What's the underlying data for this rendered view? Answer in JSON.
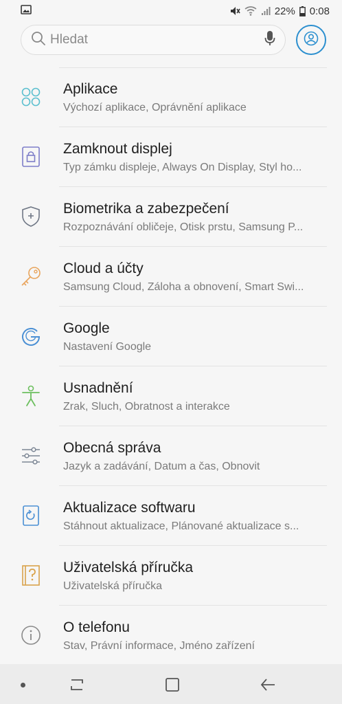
{
  "status_bar": {
    "battery": "22%",
    "time": "0:08",
    "icons": [
      "image-icon",
      "mute-icon",
      "wifi-icon",
      "signal-icon",
      "battery-icon"
    ]
  },
  "search": {
    "placeholder": "Hledat",
    "icons": [
      "search-icon",
      "microphone-icon",
      "profile-icon"
    ]
  },
  "items": [
    {
      "title": "Aplikace",
      "subtitle": "Výchozí aplikace, Oprávnění aplikace",
      "icon": "apps-icon",
      "color": "#5bbfcf"
    },
    {
      "title": "Zamknout displej",
      "subtitle": "Typ zámku displeje, Always On Display, Styl ho...",
      "icon": "lock-icon",
      "color": "#7d7dc8"
    },
    {
      "title": "Biometrika a zabezpečení",
      "subtitle": "Rozpoznávání obličeje, Otisk prstu, Samsung P...",
      "icon": "shield-icon",
      "color": "#6f7785"
    },
    {
      "title": "Cloud a účty",
      "subtitle": "Samsung Cloud, Záloha a obnovení, Smart Swi...",
      "icon": "key-icon",
      "color": "#e8a45c"
    },
    {
      "title": "Google",
      "subtitle": "Nastavení Google",
      "icon": "google-icon",
      "color": "#4a8fd4"
    },
    {
      "title": "Usnadnění",
      "subtitle": "Zrak, Sluch, Obratnost a interakce",
      "icon": "accessibility-icon",
      "color": "#6dbf5f"
    },
    {
      "title": "Obecná správa",
      "subtitle": "Jazyk a zadávání, Datum a čas, Obnovit",
      "icon": "sliders-icon",
      "color": "#7b8594"
    },
    {
      "title": "Aktualizace softwaru",
      "subtitle": "Stáhnout aktualizace, Plánované aktualizace s...",
      "icon": "update-icon",
      "color": "#4a8fd4"
    },
    {
      "title": "Uživatelská příručka",
      "subtitle": "Uživatelská příručka",
      "icon": "manual-icon",
      "color": "#d9a24a"
    },
    {
      "title": "O telefonu",
      "subtitle": "Stav, Právní informace, Jméno zařízení",
      "icon": "info-icon",
      "color": "#8a8a8a"
    }
  ],
  "nav_bar": {
    "icons": [
      "dot-icon",
      "recents-icon",
      "home-icon",
      "back-icon"
    ]
  }
}
